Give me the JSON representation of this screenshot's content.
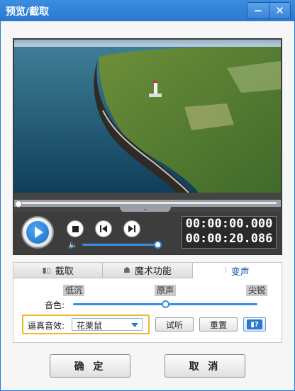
{
  "window": {
    "title": "预览/截取",
    "minimize_icon": "minimize-icon",
    "close_icon": "close-icon"
  },
  "player": {
    "progress": 0,
    "current_time": "00:00:00.000",
    "total_time": "00:00:20.086",
    "volume_level": 0.95,
    "collapse_icon": "chevron-down-icon"
  },
  "tabs": [
    {
      "label": "截取",
      "icon": "crop-icon"
    },
    {
      "label": "魔术功能",
      "icon": "magic-icon"
    },
    {
      "label": "变声",
      "icon": "voice-wave-icon",
      "active": true
    }
  ],
  "voice": {
    "scale_low": "低沉",
    "scale_mid": "原声",
    "scale_high": "尖锐",
    "tone_label": "音色:",
    "tone_level": 0.5,
    "effect_label": "逼真音效:",
    "effect_value": "花栗鼠",
    "preview_button": "试听",
    "reset_button": "重置"
  },
  "footer": {
    "ok_button": "确 定",
    "cancel_button": "取 消"
  },
  "colors": {
    "accent": "#2a78cf",
    "highlight": "#f0b72f"
  }
}
